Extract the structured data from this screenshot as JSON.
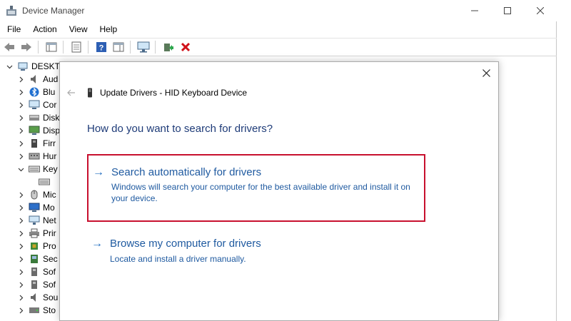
{
  "window": {
    "title": "Device Manager"
  },
  "menu": [
    "File",
    "Action",
    "View",
    "Help"
  ],
  "toolbar": [
    "back-icon",
    "forward-icon",
    "show-hide-icon",
    "properties-icon",
    "help-icon",
    "action-pane-icon",
    "monitor-icon",
    "update-driver-icon",
    "uninstall-icon"
  ],
  "tree": {
    "root": "DESKTOP",
    "items": [
      {
        "label": "Aud",
        "icon": "speaker-icon",
        "expanded": false
      },
      {
        "label": "Blu",
        "icon": "bluetooth-icon",
        "expanded": false
      },
      {
        "label": "Cor",
        "icon": "computer-icon",
        "expanded": false
      },
      {
        "label": "Disk",
        "icon": "disk-icon",
        "expanded": false
      },
      {
        "label": "Disp",
        "icon": "display-icon",
        "expanded": false
      },
      {
        "label": "Firr",
        "icon": "firmware-icon",
        "expanded": false
      },
      {
        "label": "Hur",
        "icon": "hid-icon",
        "expanded": false
      },
      {
        "label": "Key",
        "icon": "keyboard-icon",
        "expanded": true
      },
      {
        "label": "",
        "icon": "keyboard-icon",
        "child": true
      },
      {
        "label": "Mic",
        "icon": "mouse-icon",
        "expanded": false
      },
      {
        "label": "Mo",
        "icon": "monitor-icon",
        "expanded": false
      },
      {
        "label": "Net",
        "icon": "network-icon",
        "expanded": false
      },
      {
        "label": "Prir",
        "icon": "printer-icon",
        "expanded": false
      },
      {
        "label": "Pro",
        "icon": "processor-icon",
        "expanded": false
      },
      {
        "label": "Sec",
        "icon": "security-icon",
        "expanded": false
      },
      {
        "label": "Sof",
        "icon": "software-icon",
        "expanded": false
      },
      {
        "label": "Sof",
        "icon": "software-icon",
        "expanded": false
      },
      {
        "label": "Sou",
        "icon": "sound-icon",
        "expanded": false
      },
      {
        "label": "Sto",
        "icon": "storage-icon",
        "expanded": false
      }
    ]
  },
  "dialog": {
    "title": "Update Drivers - HID Keyboard Device",
    "question": "How do you want to search for drivers?",
    "options": [
      {
        "title": "Search automatically for drivers",
        "description": "Windows will search your computer for the best available driver and install it on your device.",
        "selected": true
      },
      {
        "title": "Browse my computer for drivers",
        "description": "Locate and install a driver manually.",
        "selected": false
      }
    ]
  },
  "colors": {
    "link": "#1f5aa0",
    "question": "#1e3b78",
    "highlight": "#c8102e"
  }
}
